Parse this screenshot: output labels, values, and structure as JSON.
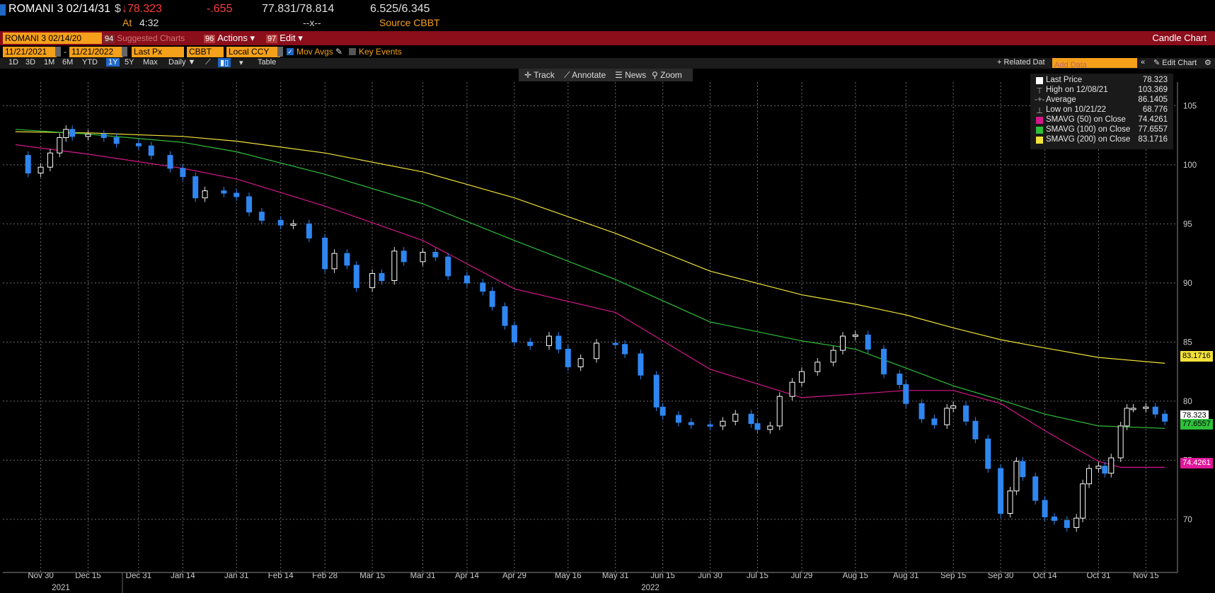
{
  "header": {
    "ticker": "ROMANI 3 02/14/31",
    "currency": "$",
    "last_price": "↓78.323",
    "change": "-.655",
    "bid_ask": "77.831/78.814",
    "yield": "6.525/6.345",
    "time_label": "At",
    "time": "4:32",
    "mid_marker": "--x--",
    "source": "Source CBBT"
  },
  "menubar": {
    "security_field": "ROMANI 3 02/14/20",
    "suggested": "Suggested Charts",
    "actions_num": "96",
    "actions": "Actions ▾",
    "edit_num": "97",
    "edit": "Edit ▾",
    "chart_type": "Candle Chart"
  },
  "params": {
    "start_date": "11/21/2021",
    "dash": "-",
    "end_date": "11/21/2022",
    "field": "Last Px",
    "source": "CBBT",
    "currency": "Local CCY",
    "mov_avgs": "Mov Avgs",
    "key_events": "Key Events"
  },
  "ranges": [
    "1D",
    "3D",
    "1M",
    "6M",
    "YTD",
    "1Y",
    "5Y",
    "Max"
  ],
  "selected_range": "1Y",
  "periodicity": "Daily ▼",
  "table_label": "Table",
  "related": "+ Related Dat",
  "add_data_placeholder": "Add Data",
  "edit_chart": "Edit Chart",
  "tools": {
    "track": "Track",
    "annotate": "Annotate",
    "news": "News",
    "zoom": "Zoom"
  },
  "legend": {
    "last_price_label": "Last Price",
    "last_price": "78.323",
    "high_label": "High on 12/08/21",
    "high": "103.369",
    "avg_label": "Average",
    "avg": "86.1405",
    "low_label": "Low on 10/21/22",
    "low": "68.776",
    "sma50_label": "SMAVG (50)  on Close",
    "sma50": "74.4261",
    "sma100_label": "SMAVG (100)  on Close",
    "sma100": "77.6557",
    "sma200_label": "SMAVG (200)  on Close",
    "sma200": "83.1716"
  },
  "colors": {
    "sma50": "#d4178a",
    "sma100": "#2fbf3a",
    "sma200": "#f2e23a",
    "up": "#ffffff",
    "down": "#2f86f0",
    "grid": "#6a6a6a"
  },
  "chart_data": {
    "type": "candlestick",
    "x_tick_labels": [
      "Nov 30",
      "Dec 15",
      "Dec 31",
      "Jan 14",
      "Jan 31",
      "Feb 14",
      "Feb 28",
      "Mar 15",
      "Mar 31",
      "Apr 14",
      "Apr 29",
      "May 16",
      "May 31",
      "Jun 15",
      "Jun 30",
      "Jul 15",
      "Jul 29",
      "Aug 15",
      "Aug 31",
      "Sep 15",
      "Sep 30",
      "Oct 14",
      "Oct 31",
      "Nov 15"
    ],
    "year_labels": [
      "2021",
      "2022"
    ],
    "y_ticks": [
      70,
      75,
      80,
      85,
      90,
      95,
      100,
      105
    ],
    "ylim": [
      65.5,
      107
    ],
    "close_points": [
      [
        "2021-11-22",
        100.8
      ],
      [
        "2021-11-26",
        99.3
      ],
      [
        "2021-11-30",
        99.8
      ],
      [
        "2021-12-03",
        101.0
      ],
      [
        "2021-12-06",
        102.3
      ],
      [
        "2021-12-08",
        103.0
      ],
      [
        "2021-12-10",
        102.4
      ],
      [
        "2021-12-15",
        102.6
      ],
      [
        "2021-12-20",
        102.3
      ],
      [
        "2021-12-24",
        101.8
      ],
      [
        "2021-12-31",
        101.6
      ],
      [
        "2022-01-04",
        100.8
      ],
      [
        "2022-01-10",
        99.7
      ],
      [
        "2022-01-14",
        99.0
      ],
      [
        "2022-01-18",
        97.2
      ],
      [
        "2022-01-21",
        97.8
      ],
      [
        "2022-01-27",
        97.6
      ],
      [
        "2022-01-31",
        97.3
      ],
      [
        "2022-02-04",
        96.0
      ],
      [
        "2022-02-08",
        95.3
      ],
      [
        "2022-02-14",
        94.9
      ],
      [
        "2022-02-18",
        95.0
      ],
      [
        "2022-02-23",
        93.8
      ],
      [
        "2022-02-28",
        91.2
      ],
      [
        "2022-03-03",
        92.5
      ],
      [
        "2022-03-07",
        91.5
      ],
      [
        "2022-03-10",
        89.6
      ],
      [
        "2022-03-15",
        90.8
      ],
      [
        "2022-03-18",
        90.2
      ],
      [
        "2022-03-22",
        92.7
      ],
      [
        "2022-03-25",
        91.8
      ],
      [
        "2022-03-31",
        92.6
      ],
      [
        "2022-04-04",
        92.2
      ],
      [
        "2022-04-08",
        90.6
      ],
      [
        "2022-04-14",
        90.0
      ],
      [
        "2022-04-19",
        89.3
      ],
      [
        "2022-04-22",
        88.0
      ],
      [
        "2022-04-26",
        86.4
      ],
      [
        "2022-04-29",
        85.0
      ],
      [
        "2022-05-04",
        84.7
      ],
      [
        "2022-05-10",
        85.5
      ],
      [
        "2022-05-13",
        84.4
      ],
      [
        "2022-05-16",
        82.9
      ],
      [
        "2022-05-20",
        83.6
      ],
      [
        "2022-05-25",
        84.9
      ],
      [
        "2022-05-31",
        84.8
      ],
      [
        "2022-06-03",
        84.0
      ],
      [
        "2022-06-08",
        82.2
      ],
      [
        "2022-06-13",
        79.5
      ],
      [
        "2022-06-15",
        78.8
      ],
      [
        "2022-06-20",
        78.2
      ],
      [
        "2022-06-24",
        78.0
      ],
      [
        "2022-06-30",
        77.9
      ],
      [
        "2022-07-04",
        78.3
      ],
      [
        "2022-07-08",
        78.9
      ],
      [
        "2022-07-13",
        78.1
      ],
      [
        "2022-07-15",
        77.6
      ],
      [
        "2022-07-19",
        77.9
      ],
      [
        "2022-07-22",
        80.4
      ],
      [
        "2022-07-26",
        81.6
      ],
      [
        "2022-07-29",
        82.5
      ],
      [
        "2022-08-03",
        83.3
      ],
      [
        "2022-08-08",
        84.3
      ],
      [
        "2022-08-11",
        85.5
      ],
      [
        "2022-08-15",
        85.6
      ],
      [
        "2022-08-19",
        84.4
      ],
      [
        "2022-08-24",
        82.3
      ],
      [
        "2022-08-29",
        81.4
      ],
      [
        "2022-08-31",
        79.8
      ],
      [
        "2022-09-05",
        78.5
      ],
      [
        "2022-09-09",
        78.0
      ],
      [
        "2022-09-13",
        79.4
      ],
      [
        "2022-09-15",
        79.6
      ],
      [
        "2022-09-19",
        78.3
      ],
      [
        "2022-09-22",
        76.8
      ],
      [
        "2022-09-26",
        74.3
      ],
      [
        "2022-09-30",
        70.5
      ],
      [
        "2022-10-03",
        72.4
      ],
      [
        "2022-10-05",
        74.9
      ],
      [
        "2022-10-07",
        73.6
      ],
      [
        "2022-10-11",
        71.6
      ],
      [
        "2022-10-14",
        70.2
      ],
      [
        "2022-10-17",
        69.9
      ],
      [
        "2022-10-21",
        69.3
      ],
      [
        "2022-10-24",
        70.1
      ],
      [
        "2022-10-26",
        73.0
      ],
      [
        "2022-10-28",
        74.3
      ],
      [
        "2022-10-31",
        74.5
      ],
      [
        "2022-11-02",
        73.9
      ],
      [
        "2022-11-04",
        75.2
      ],
      [
        "2022-11-07",
        77.9
      ],
      [
        "2022-11-09",
        79.4
      ],
      [
        "2022-11-11",
        79.4
      ],
      [
        "2022-11-15",
        79.5
      ],
      [
        "2022-11-18",
        78.9
      ],
      [
        "2022-11-21",
        78.3
      ]
    ],
    "sma50_points": [
      [
        "2021-11-22",
        101.7
      ],
      [
        "2021-12-15",
        100.9
      ],
      [
        "2022-01-14",
        99.7
      ],
      [
        "2022-01-31",
        98.8
      ],
      [
        "2022-02-28",
        96.5
      ],
      [
        "2022-03-31",
        93.6
      ],
      [
        "2022-04-29",
        89.5
      ],
      [
        "2022-05-31",
        87.5
      ],
      [
        "2022-06-30",
        82.7
      ],
      [
        "2022-07-29",
        80.3
      ],
      [
        "2022-08-15",
        80.6
      ],
      [
        "2022-08-31",
        80.9
      ],
      [
        "2022-09-15",
        80.9
      ],
      [
        "2022-09-30",
        79.8
      ],
      [
        "2022-10-14",
        77.5
      ],
      [
        "2022-10-31",
        74.9
      ],
      [
        "2022-11-07",
        74.4
      ],
      [
        "2022-11-21",
        74.4
      ]
    ],
    "sma100_points": [
      [
        "2021-11-22",
        103.0
      ],
      [
        "2021-12-15",
        102.6
      ],
      [
        "2022-01-14",
        101.9
      ],
      [
        "2022-01-31",
        101.1
      ],
      [
        "2022-02-28",
        99.2
      ],
      [
        "2022-03-31",
        96.7
      ],
      [
        "2022-04-29",
        93.6
      ],
      [
        "2022-05-31",
        90.3
      ],
      [
        "2022-06-30",
        86.7
      ],
      [
        "2022-07-29",
        85.1
      ],
      [
        "2022-08-15",
        84.4
      ],
      [
        "2022-08-31",
        82.8
      ],
      [
        "2022-09-15",
        81.3
      ],
      [
        "2022-09-30",
        80.1
      ],
      [
        "2022-10-14",
        78.9
      ],
      [
        "2022-10-31",
        77.9
      ],
      [
        "2022-11-21",
        77.7
      ]
    ],
    "sma200_points": [
      [
        "2021-11-22",
        102.8
      ],
      [
        "2021-12-15",
        102.7
      ],
      [
        "2022-01-14",
        102.4
      ],
      [
        "2022-01-31",
        102.0
      ],
      [
        "2022-02-28",
        101.0
      ],
      [
        "2022-03-31",
        99.4
      ],
      [
        "2022-04-29",
        97.2
      ],
      [
        "2022-05-31",
        94.2
      ],
      [
        "2022-06-30",
        91.0
      ],
      [
        "2022-07-29",
        89.0
      ],
      [
        "2022-08-15",
        88.2
      ],
      [
        "2022-08-31",
        87.3
      ],
      [
        "2022-09-15",
        86.2
      ],
      [
        "2022-09-30",
        85.2
      ],
      [
        "2022-10-14",
        84.5
      ],
      [
        "2022-10-31",
        83.7
      ],
      [
        "2022-11-21",
        83.2
      ]
    ]
  }
}
